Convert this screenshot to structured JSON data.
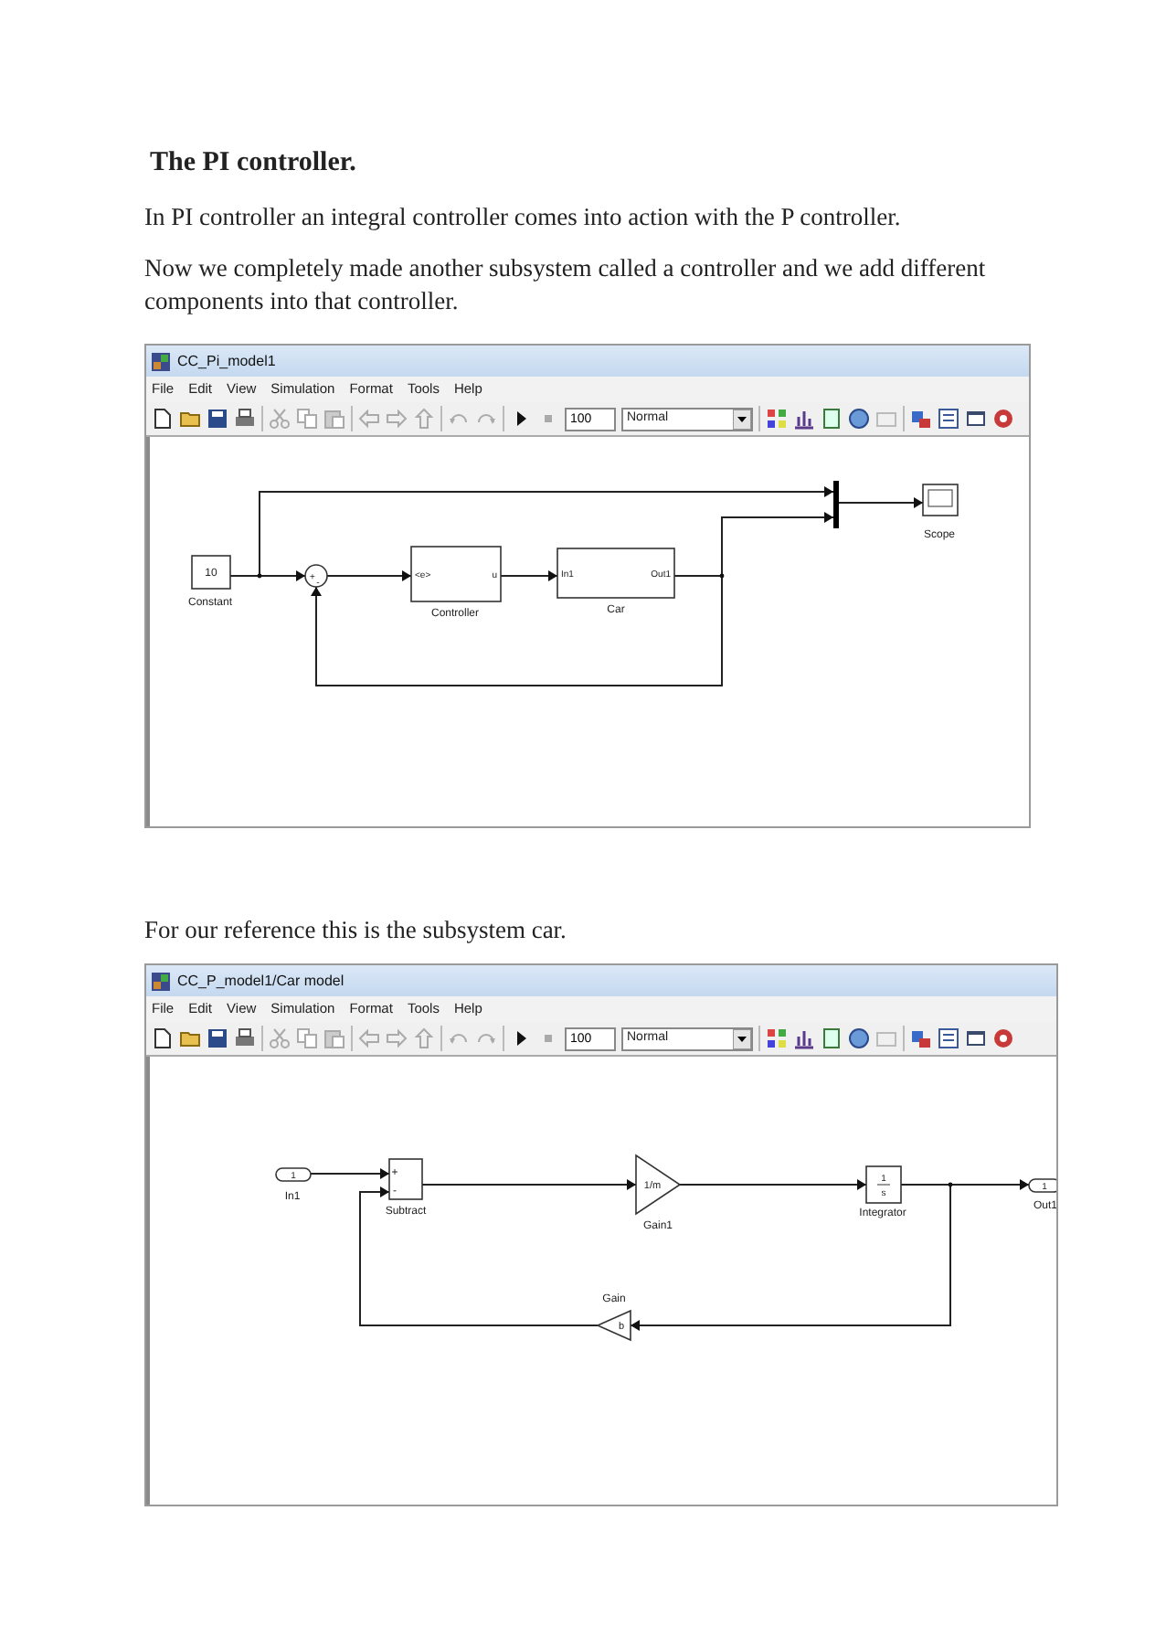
{
  "heading": "The PI controller.",
  "paragraphs": [
    "In PI controller an integral controller comes into action  with the P controller.",
    "Now we completely made another subsystem called a controller and we add different components into that controller."
  ],
  "windows": [
    {
      "title": "CC_Pi_model1",
      "menu": [
        "File",
        "Edit",
        "View",
        "Simulation",
        "Format",
        "Tools",
        "Help"
      ],
      "stop_time": "100",
      "mode": "Normal",
      "blocks": [
        {
          "kind": "constant",
          "value": "10",
          "label": "Constant"
        },
        {
          "kind": "sum",
          "signs": [
            "+",
            "-"
          ]
        },
        {
          "kind": "subsystem",
          "in_port": "<e>",
          "out_port": "u",
          "label": "Controller"
        },
        {
          "kind": "subsystem",
          "in_port": "In1",
          "out_port": "Out1",
          "label": "Car"
        },
        {
          "kind": "mux"
        },
        {
          "kind": "scope",
          "label": "Scope"
        }
      ]
    },
    {
      "caption": "For our reference this is the subsystem car.",
      "title": "CC_P_model1/Car model",
      "menu": [
        "File",
        "Edit",
        "View",
        "Simulation",
        "Format",
        "Tools",
        "Help"
      ],
      "stop_time": "100",
      "mode": "Normal",
      "blocks": [
        {
          "kind": "inport",
          "value": "1",
          "label": "In1"
        },
        {
          "kind": "sum_box",
          "signs": [
            "+",
            "-"
          ],
          "label": "Subtract"
        },
        {
          "kind": "gain",
          "value": "1/m",
          "label": "Gain1"
        },
        {
          "kind": "integrator",
          "numerator": "1",
          "denominator": "s",
          "label": "Integrator"
        },
        {
          "kind": "outport",
          "value": "1",
          "label": "Out1"
        },
        {
          "kind": "gain_left",
          "value": "b",
          "label": "Gain"
        }
      ]
    }
  ]
}
